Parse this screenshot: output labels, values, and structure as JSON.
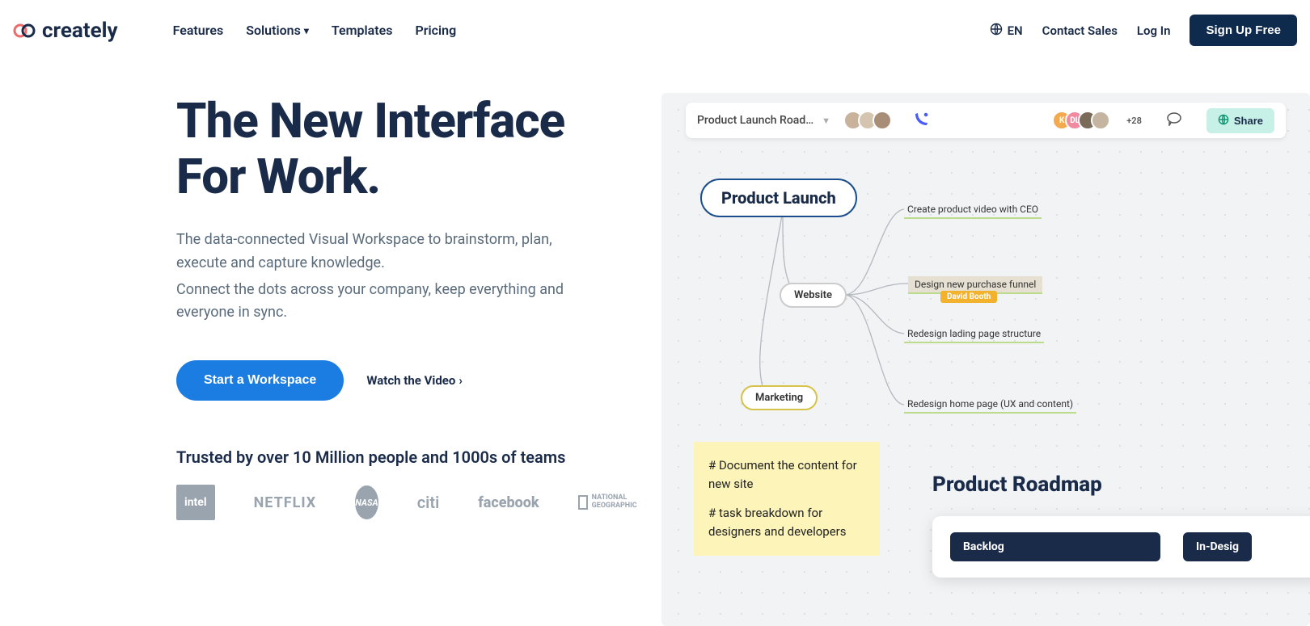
{
  "brand": {
    "name": "creately"
  },
  "nav": {
    "features": "Features",
    "solutions": "Solutions",
    "templates": "Templates",
    "pricing": "Pricing"
  },
  "header": {
    "lang": "EN",
    "contact": "Contact Sales",
    "login": "Log In",
    "signup": "Sign Up Free"
  },
  "hero": {
    "headline": "The New Interface For Work.",
    "sub1": "The data-connected Visual Workspace to brainstorm, plan, execute and capture knowledge.",
    "sub2": "Connect the dots across your company, keep everything and everyone in sync.",
    "cta_primary": "Start a Workspace",
    "cta_video": "Watch the Video",
    "trusted": "Trusted by over 10 Million people and 1000s of teams",
    "brands": {
      "intel": "intel",
      "netflix": "NETFLIX",
      "nasa": "NASA",
      "citi": "citi",
      "facebook": "facebook",
      "natgeo_l1": "NATIONAL",
      "natgeo_l2": "GEOGRAPHIC"
    }
  },
  "canvas": {
    "file_name": "Product Launch Road…",
    "more_count": "+28",
    "share": "Share",
    "root": "Product Launch",
    "website": "Website",
    "marketing": "Marketing",
    "tasks": {
      "t1": "Create product video with CEO",
      "t2": "Design new purchase funnel",
      "t2_assignee": "David Booth",
      "t3": "Redesign lading page structure",
      "t4": "Redesign home page (UX and content)"
    },
    "sticky": {
      "l1": "# Document the content for new site",
      "l2": "# task breakdown for designers and developers"
    },
    "roadmap_title": "Product Roadmap",
    "columns": {
      "backlog": "Backlog",
      "indesign": "In-Desig"
    }
  }
}
